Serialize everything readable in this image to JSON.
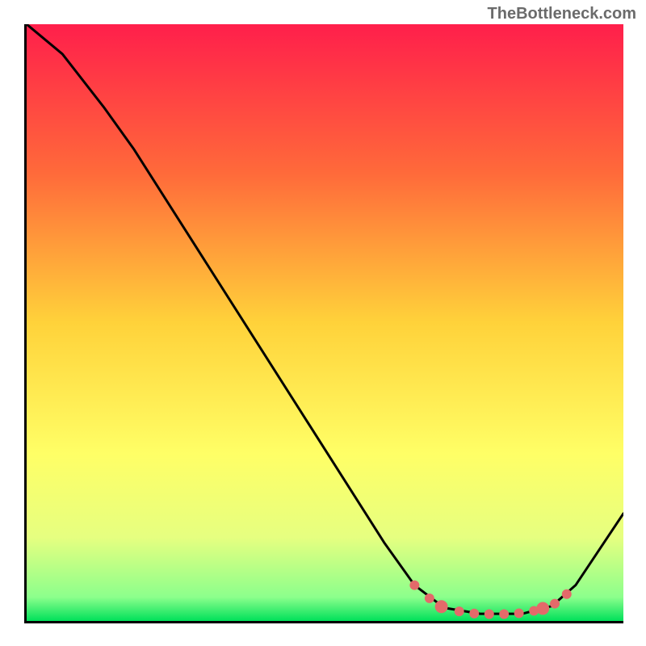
{
  "watermark": "TheBottleneck.com",
  "chart_data": {
    "type": "line",
    "title": "",
    "xlabel": "",
    "ylabel": "",
    "xlim": [
      0,
      100
    ],
    "ylim": [
      0,
      100
    ],
    "gradient_stops": [
      {
        "offset": 0,
        "color": "#ff1f4b"
      },
      {
        "offset": 0.25,
        "color": "#ff6a3a"
      },
      {
        "offset": 0.5,
        "color": "#ffd23a"
      },
      {
        "offset": 0.72,
        "color": "#ffff66"
      },
      {
        "offset": 0.86,
        "color": "#e6ff80"
      },
      {
        "offset": 0.96,
        "color": "#8cff8c"
      },
      {
        "offset": 1.0,
        "color": "#00e05a"
      }
    ],
    "series": [
      {
        "name": "curve",
        "points": [
          {
            "x": 0,
            "y": 100
          },
          {
            "x": 6,
            "y": 95
          },
          {
            "x": 13,
            "y": 86
          },
          {
            "x": 18,
            "y": 79
          },
          {
            "x": 60,
            "y": 13
          },
          {
            "x": 65,
            "y": 6
          },
          {
            "x": 70,
            "y": 2.2
          },
          {
            "x": 76,
            "y": 1.2
          },
          {
            "x": 83,
            "y": 1.2
          },
          {
            "x": 88,
            "y": 2.5
          },
          {
            "x": 92,
            "y": 6
          },
          {
            "x": 100,
            "y": 18
          }
        ],
        "stroke": "#000000",
        "stroke_width": 3
      }
    ],
    "markers": {
      "color": "#e36a6a",
      "radius_small": 6,
      "radius_large": 8,
      "points": [
        {
          "x": 65,
          "y": 6.0,
          "r": "small"
        },
        {
          "x": 67.5,
          "y": 3.8,
          "r": "small"
        },
        {
          "x": 69.5,
          "y": 2.4,
          "r": "large"
        },
        {
          "x": 72.5,
          "y": 1.6,
          "r": "small"
        },
        {
          "x": 75,
          "y": 1.25,
          "r": "small"
        },
        {
          "x": 77.5,
          "y": 1.15,
          "r": "small"
        },
        {
          "x": 80,
          "y": 1.15,
          "r": "small"
        },
        {
          "x": 82.5,
          "y": 1.3,
          "r": "small"
        },
        {
          "x": 85,
          "y": 1.7,
          "r": "small"
        },
        {
          "x": 86.5,
          "y": 2.1,
          "r": "large"
        },
        {
          "x": 88.5,
          "y": 2.9,
          "r": "small"
        },
        {
          "x": 90.5,
          "y": 4.5,
          "r": "small"
        }
      ]
    }
  }
}
